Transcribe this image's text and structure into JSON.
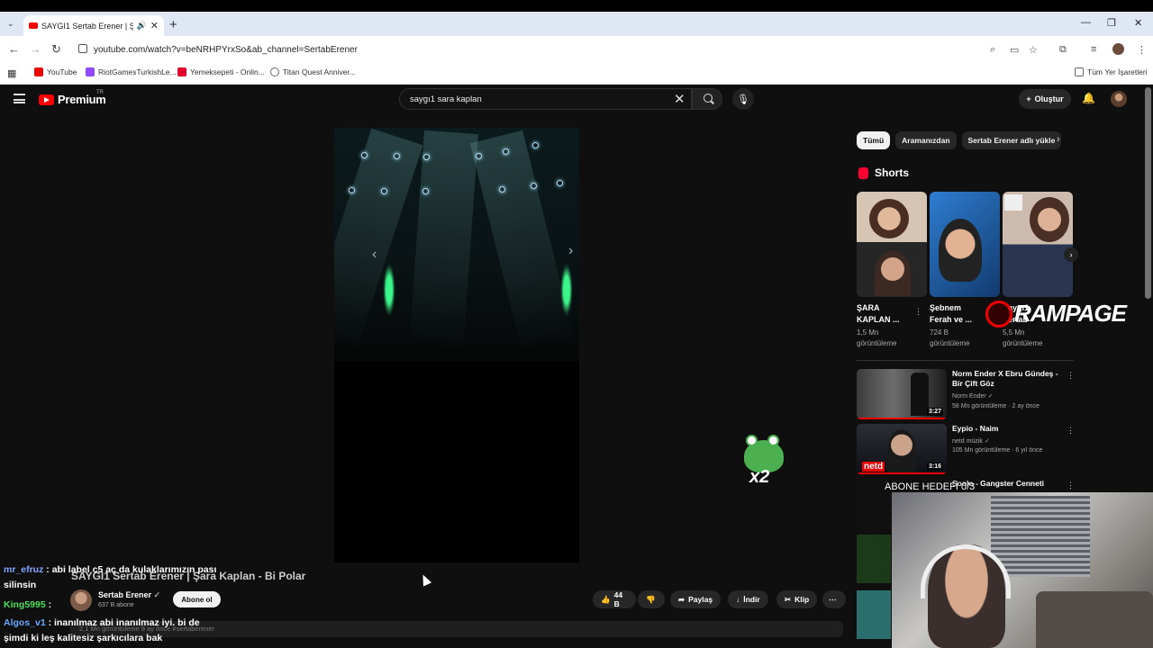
{
  "browser": {
    "tab_title": "SAYGI1 Sertab Erener | Şara",
    "url": "youtube.com/watch?v=beNRHPYrxSo&ab_channel=SertabErener",
    "bookmarks": [
      "YouTube",
      "RiotGamesTurkishLe...",
      "Yemeksepeti - Onlin...",
      "Titan Quest Anniver..."
    ],
    "all_bookmarks": "Tüm Yer İşaretleri"
  },
  "youtube": {
    "logo_text": "Premium",
    "region": "TR",
    "search_query": "saygı1 sara kaplan",
    "create_label": "Oluştur"
  },
  "video": {
    "title": "SAYGI1 Sertab Erener | Şara Kaplan - Bi Polar",
    "channel": "Sertab Erener",
    "subscribers": "637 B abone",
    "subscribe_label": "Abone ol",
    "likes": "44 B",
    "share_label": "Paylaş",
    "download_label": "İndir",
    "clip_label": "Klip",
    "description": "2,1 Mn görüntüleme  9 ay önce  #sertaberener"
  },
  "chips": [
    "Tümü",
    "Aramanızdan",
    "Sertab Erener adlı yükle"
  ],
  "shorts": {
    "heading": "Shorts",
    "items": [
      {
        "title_l1": "ŞARA",
        "title_l2": "KAPLAN ...",
        "views_l1": "1,5 Mn",
        "views_l2": "görüntüleme"
      },
      {
        "title_l1": "Şebnem",
        "title_l2": "Ferah ve ...",
        "views_l1": "724 B",
        "views_l2": "görüntüleme"
      },
      {
        "title_l1": "Saygı1",
        "title_l2": "Sertab",
        "views_l1": "5,5 Mn",
        "views_l2": "görüntüleme"
      }
    ]
  },
  "overlay": {
    "rampage": "RAMPAGE",
    "abone_hedefi": "ABONE HEDEFİ 0/3",
    "multiplier": "x2"
  },
  "recommendations": [
    {
      "title": "Norm Ender X Ebru Gündeş - Bir Çift Göz",
      "channel": "Norm Ender",
      "views": "58 Mn görüntüleme · 2 ay önce",
      "duration": "3:27"
    },
    {
      "title": "Eypio - Naim",
      "channel": "netd müzik",
      "views": "105 Mn görüntüleme · 6 yıl önce",
      "duration": "3:16",
      "badge": "netd"
    },
    {
      "title": "Soolo - Gangster Cenneti",
      "channel": "",
      "views": "",
      "duration": ""
    }
  ],
  "chat": [
    {
      "user": "mr_efruz",
      "line1": " : abi label c5 aç da kulaklarımızın pası",
      "line2": "silinsin"
    },
    {
      "user": "King5995",
      "line1": " :",
      "line2": ""
    },
    {
      "user": "Algos_v1",
      "line1": " : inanılmaz abi inanılmaz iyi. bi de",
      "line2": "şimdi ki leş kalitesiz şarkıcılara bak"
    }
  ]
}
